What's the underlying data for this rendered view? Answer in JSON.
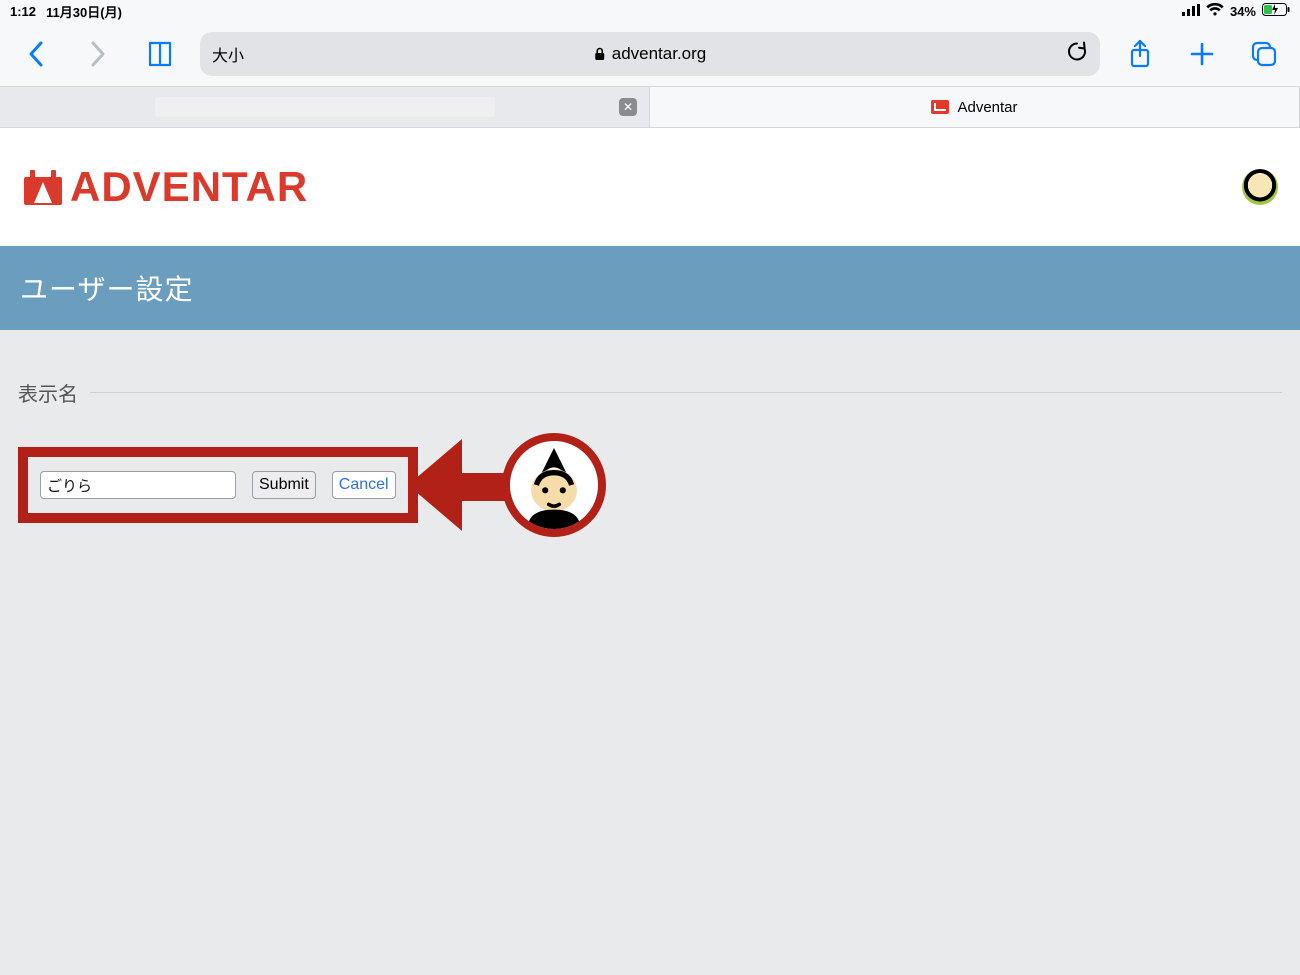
{
  "status": {
    "time": "1:12",
    "date": "11月30日(月)",
    "battery_pct": "34%"
  },
  "safari": {
    "text_size_label": "大小",
    "url": "adventar.org"
  },
  "tabs": {
    "active_title": "Adventar"
  },
  "site": {
    "logo_text": "ADVENTAR"
  },
  "page": {
    "title": "ユーザー設定",
    "display_name_label": "表示名",
    "display_name_value": "ごりら",
    "submit_label": "Submit",
    "cancel_label": "Cancel"
  }
}
